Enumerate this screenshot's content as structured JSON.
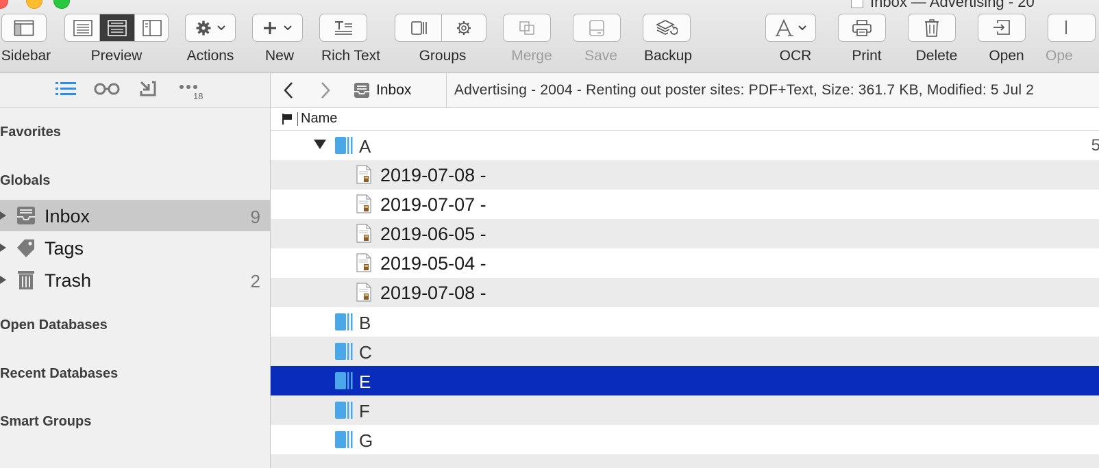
{
  "window": {
    "title_right": "Inbox — Advertising - 20"
  },
  "toolbar": {
    "sidebar_label": "Sidebar",
    "preview_label": "Preview",
    "actions_label": "Actions",
    "new_label": "New",
    "rich_text_label": "Rich Text",
    "groups_label": "Groups",
    "merge_label": "Merge",
    "save_label": "Save",
    "backup_label": "Backup",
    "ocr_label": "OCR",
    "print_label": "Print",
    "delete_label": "Delete",
    "open_label": "Open",
    "open_with_label": "Ope"
  },
  "sidebar": {
    "tab_badge": "18",
    "favorites_heading": "Favorites",
    "globals_heading": "Globals",
    "globals": [
      {
        "label": "Inbox",
        "count": "9"
      },
      {
        "label": "Tags",
        "count": ""
      },
      {
        "label": "Trash",
        "count": "2"
      }
    ],
    "open_databases_heading": "Open Databases",
    "recent_databases_heading": "Recent Databases",
    "smart_groups_heading": "Smart Groups"
  },
  "navbar": {
    "location": "Inbox",
    "info": "Advertising - 2004 - Renting out poster sites: PDF+Text, Size: 361.7 KB, Modified: 5 Jul 2"
  },
  "list": {
    "name_header": "Name",
    "group_a": {
      "name": "A",
      "count": "5"
    },
    "documents": [
      "2019-07-08 -",
      "2019-07-07 -",
      "2019-06-05 -",
      "2019-05-04 -",
      "2019-07-08 -"
    ],
    "groups": [
      "B",
      "C",
      "E",
      "F",
      "G"
    ]
  },
  "colors": {
    "selection": "#0a2cbd",
    "accent_blue": "#2a8fe6",
    "group_blue": "#4aa7ea"
  }
}
